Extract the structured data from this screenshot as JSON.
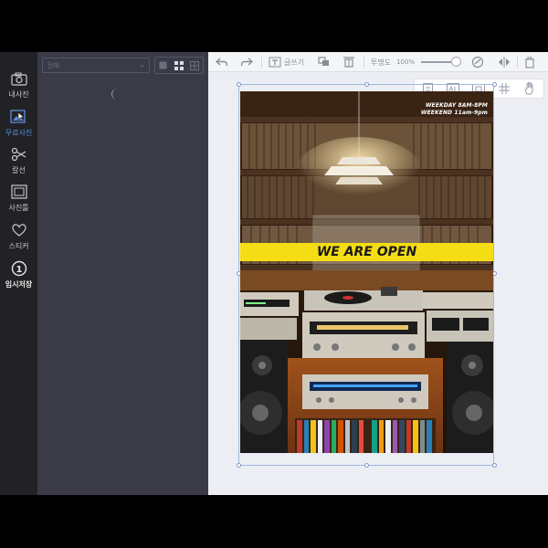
{
  "sidebar": {
    "items": [
      {
        "label": "내사진",
        "icon": "camera-icon"
      },
      {
        "label": "무료사진",
        "icon": "image-icon"
      },
      {
        "label": "칼선",
        "icon": "scissors-icon"
      },
      {
        "label": "사진틀",
        "icon": "frame-icon"
      },
      {
        "label": "스티커",
        "icon": "heart-icon"
      },
      {
        "label": "임시저장",
        "icon": "temp-save-icon"
      }
    ],
    "temp_save_badge": "1"
  },
  "panel": {
    "select_value": "전체",
    "view_modes": [
      "single-view-icon",
      "grid-view-icon",
      "list-view-icon"
    ]
  },
  "toolbar": {
    "text_add_label": "글쓰기",
    "opacity_label": "투명도",
    "opacity_value": "100%",
    "opacity_level": 1.0
  },
  "poster": {
    "hours_line1": "WEEKDAY 8AM-8PM",
    "hours_line2": "WEEKEND 11am-9pm",
    "banner_text": "WE ARE OPEN",
    "banner_color": "#f4dd14"
  },
  "colors": {
    "rail_bg": "#222226",
    "panel_bg": "#3a3b47",
    "accent": "#5b8dd9",
    "canvas_bg": "#eceef3"
  }
}
